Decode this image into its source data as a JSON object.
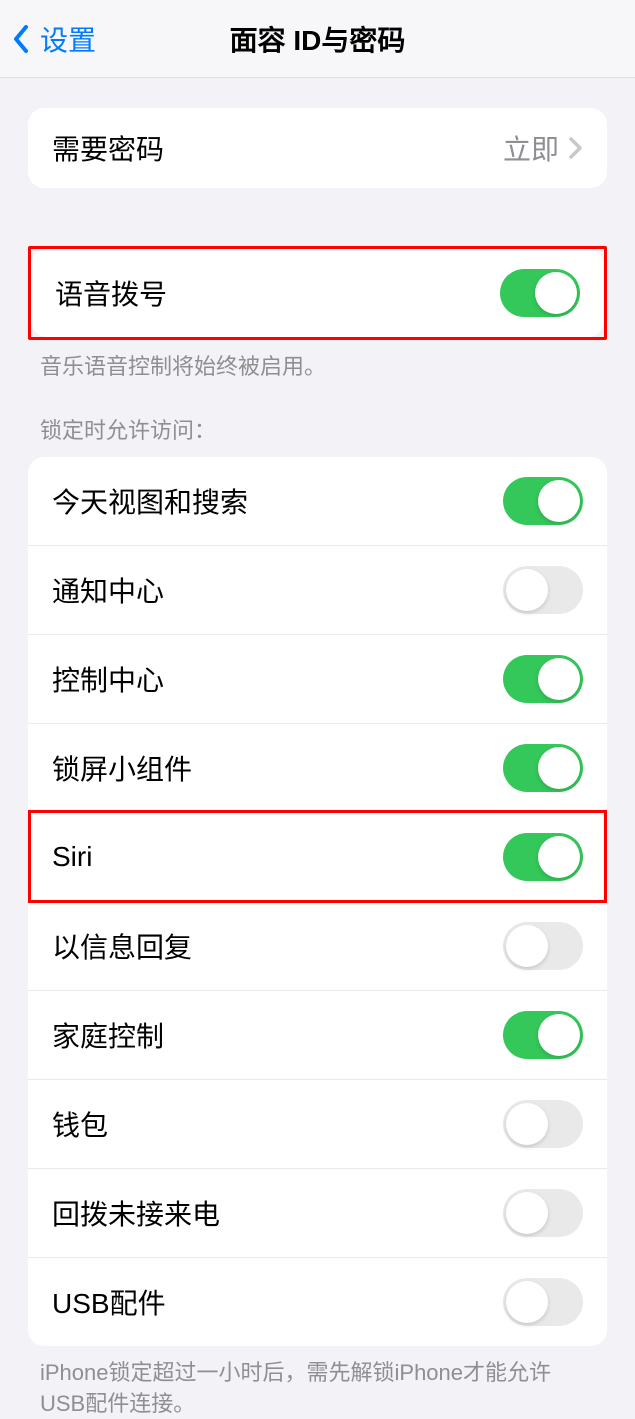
{
  "header": {
    "back_label": "设置",
    "title": "面容 ID与密码"
  },
  "passcode_section": {
    "require_passcode_label": "需要密码",
    "require_passcode_value": "立即"
  },
  "voice_dial_section": {
    "voice_dial_label": "语音拨号",
    "voice_dial_on": true,
    "footer": "音乐语音控制将始终被启用。"
  },
  "access_section": {
    "header": "锁定时允许访问：",
    "items": [
      {
        "label": "今天视图和搜索",
        "on": true,
        "name": "today-view-toggle"
      },
      {
        "label": "通知中心",
        "on": false,
        "name": "notification-center-toggle"
      },
      {
        "label": "控制中心",
        "on": true,
        "name": "control-center-toggle"
      },
      {
        "label": "锁屏小组件",
        "on": true,
        "name": "lock-screen-widgets-toggle"
      },
      {
        "label": "Siri",
        "on": true,
        "name": "siri-toggle",
        "highlighted": true
      },
      {
        "label": "以信息回复",
        "on": false,
        "name": "reply-with-message-toggle"
      },
      {
        "label": "家庭控制",
        "on": true,
        "name": "home-control-toggle"
      },
      {
        "label": "钱包",
        "on": false,
        "name": "wallet-toggle"
      },
      {
        "label": "回拨未接来电",
        "on": false,
        "name": "return-missed-calls-toggle"
      },
      {
        "label": "USB配件",
        "on": false,
        "name": "usb-accessories-toggle"
      }
    ],
    "footer": "iPhone锁定超过一小时后，需先解锁iPhone才能允许USB配件连接。"
  },
  "colors": {
    "accent": "#007aff",
    "toggle_on": "#34c759",
    "toggle_off": "#e9e9ea",
    "highlight": "#ff0000"
  }
}
